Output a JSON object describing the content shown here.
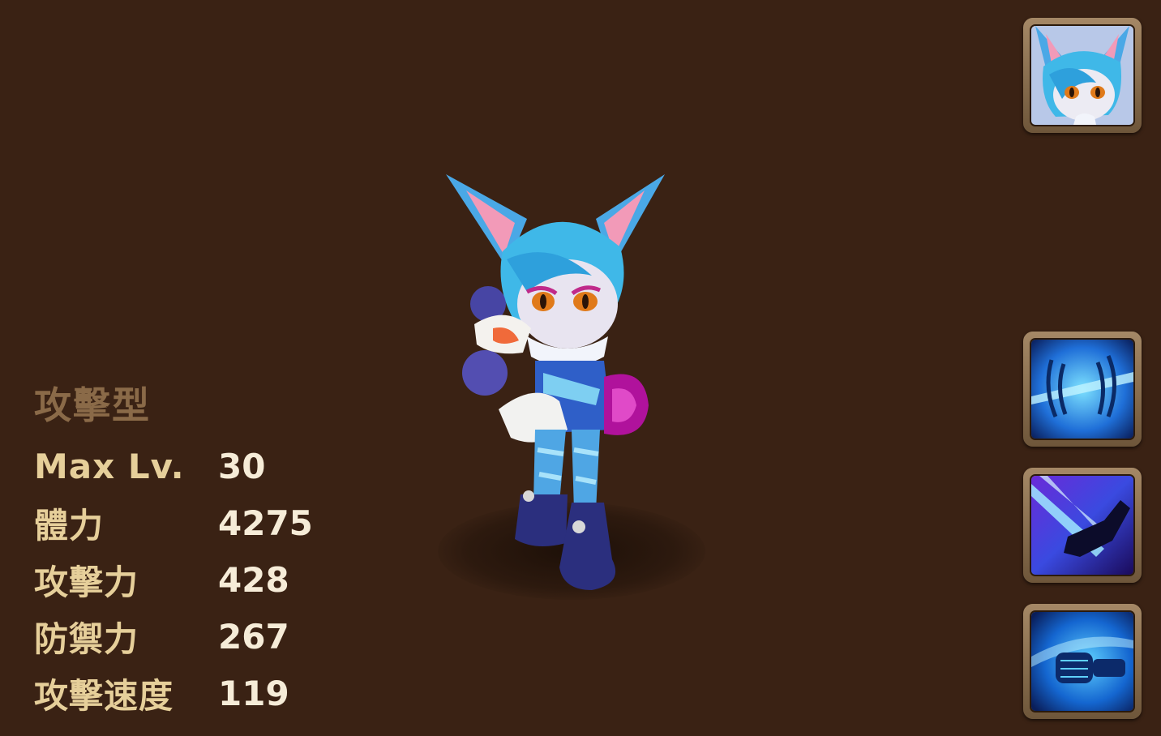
{
  "monster": {
    "type": "攻擊型",
    "stats": [
      {
        "label": "Max Lv.",
        "value": "30"
      },
      {
        "label": "體力",
        "value": "4275"
      },
      {
        "label": "攻擊力",
        "value": "428"
      },
      {
        "label": "防禦力",
        "value": "267"
      },
      {
        "label": "攻擊速度",
        "value": "119"
      }
    ]
  },
  "icons": {
    "portrait": "cat-girl-portrait-icon",
    "skill_1": "claw-slash-skill-icon",
    "skill_2": "flying-kick-skill-icon",
    "skill_3": "fist-punch-skill-icon"
  },
  "colors": {
    "background": "#3a2214",
    "type_label": "#8a6a48",
    "stat_label": "#e6cf9a",
    "stat_value": "#f6ecd8",
    "frame": "#a58866",
    "skill_blue": "#1f6fd8"
  }
}
